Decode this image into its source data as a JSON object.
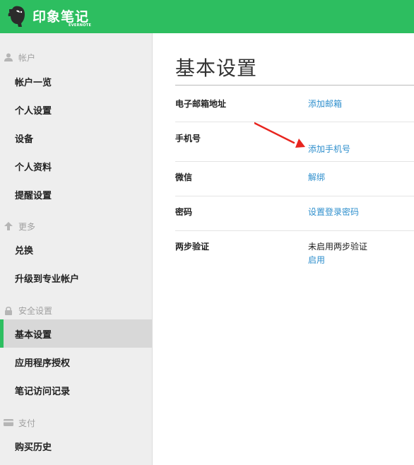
{
  "header": {
    "logo_text": "印象笔记",
    "logo_sub": "EVERNOTE",
    "bg_color": "#2dbe60"
  },
  "sidebar": {
    "sections": [
      {
        "label": "帐户",
        "icon": "user-icon"
      },
      {
        "label": "更多",
        "icon": "arrow-up-icon"
      },
      {
        "label": "安全设置",
        "icon": "lock-icon"
      },
      {
        "label": "支付",
        "icon": "credit-card-icon"
      }
    ],
    "items": [
      {
        "label": "帐户一览"
      },
      {
        "label": "个人设置"
      },
      {
        "label": "设备"
      },
      {
        "label": "个人资料"
      },
      {
        "label": "提醒设置"
      },
      {
        "label": "兑换"
      },
      {
        "label": "升级到专业帐户"
      },
      {
        "label": "基本设置",
        "active": true
      },
      {
        "label": "应用程序授权"
      },
      {
        "label": "笔记访问记录"
      },
      {
        "label": "购买历史"
      }
    ],
    "accent_color": "#2dbe60"
  },
  "main": {
    "title": "基本设置",
    "rows": [
      {
        "label": "电子邮箱地址",
        "value": "添加邮箱"
      },
      {
        "label": "手机号",
        "value": "添加手机号"
      },
      {
        "label": "微信",
        "value": "解绑"
      },
      {
        "label": "密码",
        "value": "设置登录密码"
      },
      {
        "label": "两步验证",
        "status": "未启用两步验证",
        "value": "启用"
      }
    ],
    "link_color": "#2f8fcd",
    "annotation_color": "#e8251f"
  }
}
